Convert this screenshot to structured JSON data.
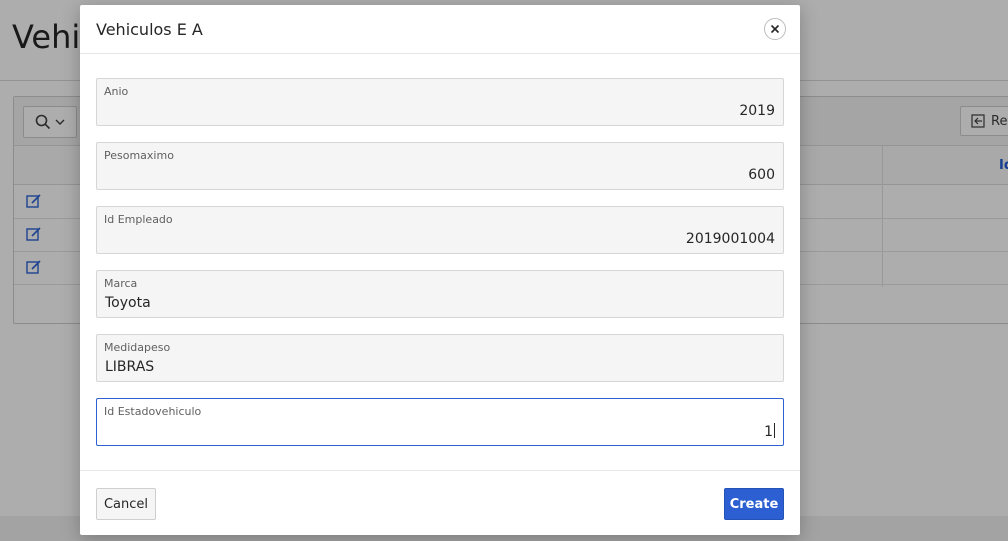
{
  "background": {
    "page_title_partial": "Vehic",
    "reset_button_partial": "Res",
    "column_header_partial": "Id",
    "edit_rows": 3
  },
  "dialog": {
    "title": "Vehiculos E A",
    "close_icon": "close-icon",
    "fields": [
      {
        "label": "Anio",
        "value": "2019",
        "align": "right"
      },
      {
        "label": "Pesomaximo",
        "value": "600",
        "align": "right"
      },
      {
        "label": "Id Empleado",
        "value": "2019001004",
        "align": "right"
      },
      {
        "label": "Marca",
        "value": "Toyota",
        "align": "left"
      },
      {
        "label": "Medidapeso",
        "value": "LIBRAS",
        "align": "left"
      },
      {
        "label": "Id Estadovehiculo",
        "value": "1",
        "align": "right",
        "focused": true
      }
    ],
    "cancel_label": "Cancel",
    "create_label": "Create"
  },
  "colors": {
    "primary": "#2c5fd1",
    "overlay": "rgba(0,0,0,0.32)",
    "field_bg": "#f5f5f5"
  }
}
